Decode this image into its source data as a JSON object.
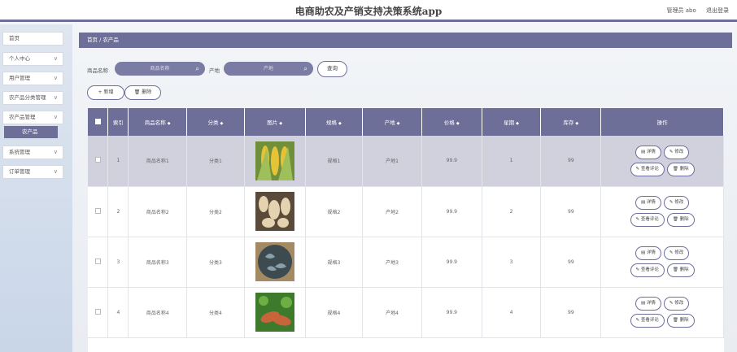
{
  "header": {
    "title": "电商助农及产销支持决策系统app",
    "user": "管理员 abo",
    "logout": "退出登录"
  },
  "sidebar": {
    "items": [
      {
        "label": "首页",
        "chev": ""
      },
      {
        "label": "个人中心",
        "chev": "∨"
      },
      {
        "label": "用户管理",
        "chev": "∨"
      },
      {
        "label": "农产品分类管理",
        "chev": "∨"
      },
      {
        "label": "农产品管理",
        "chev": "∨"
      },
      {
        "label": "系统管理",
        "chev": "∨"
      },
      {
        "label": "订单管理",
        "chev": "∨"
      }
    ],
    "sub_item": "农产品"
  },
  "breadcrumb": "首页 / 农产品",
  "search": {
    "name_label": "商品名称",
    "name_placeholder": "商品名称",
    "origin_label": "产地",
    "origin_placeholder": "产地",
    "query_button": "查询"
  },
  "toolbar": {
    "add": "+ 新增",
    "delete": "删除"
  },
  "table": {
    "headers": [
      "",
      "索引",
      "商品名称",
      "分类",
      "图片",
      "规格",
      "产地",
      "价格",
      "星期",
      "库存",
      "操作"
    ],
    "rows": [
      {
        "index": "1",
        "name": "商品名称1",
        "category": "分类1",
        "spec": "规格1",
        "origin": "产地1",
        "price": "99.9",
        "week": "1",
        "stock": "99",
        "image": "corn"
      },
      {
        "index": "2",
        "name": "商品名称2",
        "category": "分类2",
        "spec": "规格2",
        "origin": "产地2",
        "price": "99.9",
        "week": "2",
        "stock": "99",
        "image": "roots"
      },
      {
        "index": "3",
        "name": "商品名称3",
        "category": "分类3",
        "spec": "规格3",
        "origin": "产地3",
        "price": "99.9",
        "week": "3",
        "stock": "99",
        "image": "fungus"
      },
      {
        "index": "4",
        "name": "商品名称4",
        "category": "分类4",
        "spec": "规格4",
        "origin": "产地4",
        "price": "99.9",
        "week": "4",
        "stock": "99",
        "image": "sweet-potato"
      }
    ],
    "ops": {
      "detail": "详情",
      "edit": "修改",
      "review": "查看评论",
      "delete": "删除"
    }
  },
  "colors": {
    "accent": "#6e6f98",
    "selected_row": "#d0d1dc"
  }
}
